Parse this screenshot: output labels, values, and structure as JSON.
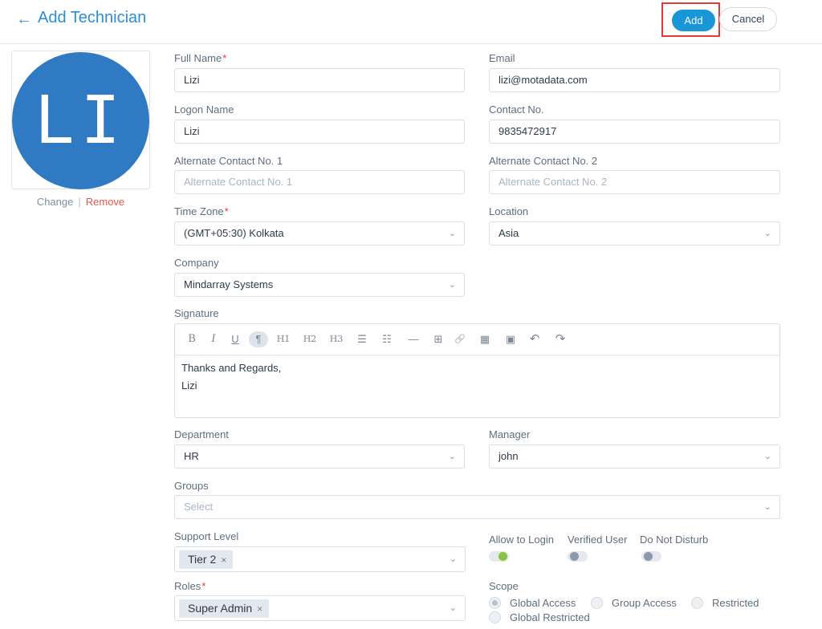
{
  "header": {
    "back_icon": "arrow-left-icon",
    "title": "Add Technician",
    "add_label": "Add",
    "cancel_label": "Cancel"
  },
  "avatar": {
    "initials": "LI",
    "bg_color": "#2f7ac3",
    "change_label": "Change",
    "separator": "|",
    "remove_label": "Remove"
  },
  "fields": {
    "full_name": {
      "label": "Full Name",
      "required": "*",
      "value": "Lizi"
    },
    "email": {
      "label": "Email",
      "value": "lizi@motadata.com"
    },
    "logon_name": {
      "label": "Logon Name",
      "value": "Lizi"
    },
    "contact_no": {
      "label": "Contact No.",
      "value": "9835472917"
    },
    "alt_contact_1": {
      "label": "Alternate Contact No. 1",
      "placeholder": "Alternate Contact No. 1"
    },
    "alt_contact_2": {
      "label": "Alternate Contact No. 2",
      "placeholder": "Alternate Contact No. 2"
    },
    "time_zone": {
      "label": "Time Zone",
      "required": "*",
      "value": "(GMT+05:30) Kolkata"
    },
    "location": {
      "label": "Location",
      "value": "Asia"
    },
    "company": {
      "label": "Company",
      "value": "Mindarray Systems"
    },
    "signature": {
      "label": "Signature",
      "line1": "Thanks and Regards,",
      "line2": "Lizi",
      "toolbar": {
        "bold": "B",
        "italic": "I",
        "underline": "U",
        "paragraph": "¶",
        "h1": "H1",
        "h2": "H2",
        "h3": "H3",
        "bullet_list": "☰",
        "ordered_list": "☷",
        "horizontal_rule": "—",
        "table": "⊞",
        "link": "🔗",
        "video": "▦",
        "image": "▣",
        "undo": "↶",
        "redo": "↷"
      }
    },
    "department": {
      "label": "Department",
      "value": "HR"
    },
    "manager": {
      "label": "Manager",
      "value": "john"
    },
    "groups": {
      "label": "Groups",
      "placeholder": "Select"
    },
    "support_level": {
      "label": "Support Level",
      "tag": "Tier 2",
      "remove": "×"
    },
    "roles": {
      "label": "Roles",
      "required": "*",
      "tag": "Super Admin",
      "remove": "×"
    }
  },
  "toggles": {
    "allow_login": {
      "label": "Allow to Login",
      "on": true,
      "color": "#8ac43f"
    },
    "verified_user": {
      "label": "Verified User",
      "on": false
    },
    "do_not_disturb": {
      "label": "Do Not Disturb",
      "on": false
    }
  },
  "scope": {
    "label": "Scope",
    "options": [
      {
        "label": "Global Access",
        "selected": true
      },
      {
        "label": "Group Access",
        "selected": false
      },
      {
        "label": "Restricted",
        "selected": false
      },
      {
        "label": "Global Restricted",
        "selected": false
      }
    ]
  },
  "colors": {
    "accent": "#1896d8",
    "title": "#2b8fd1",
    "required": "#e53935",
    "remove_link": "#e4574c"
  }
}
